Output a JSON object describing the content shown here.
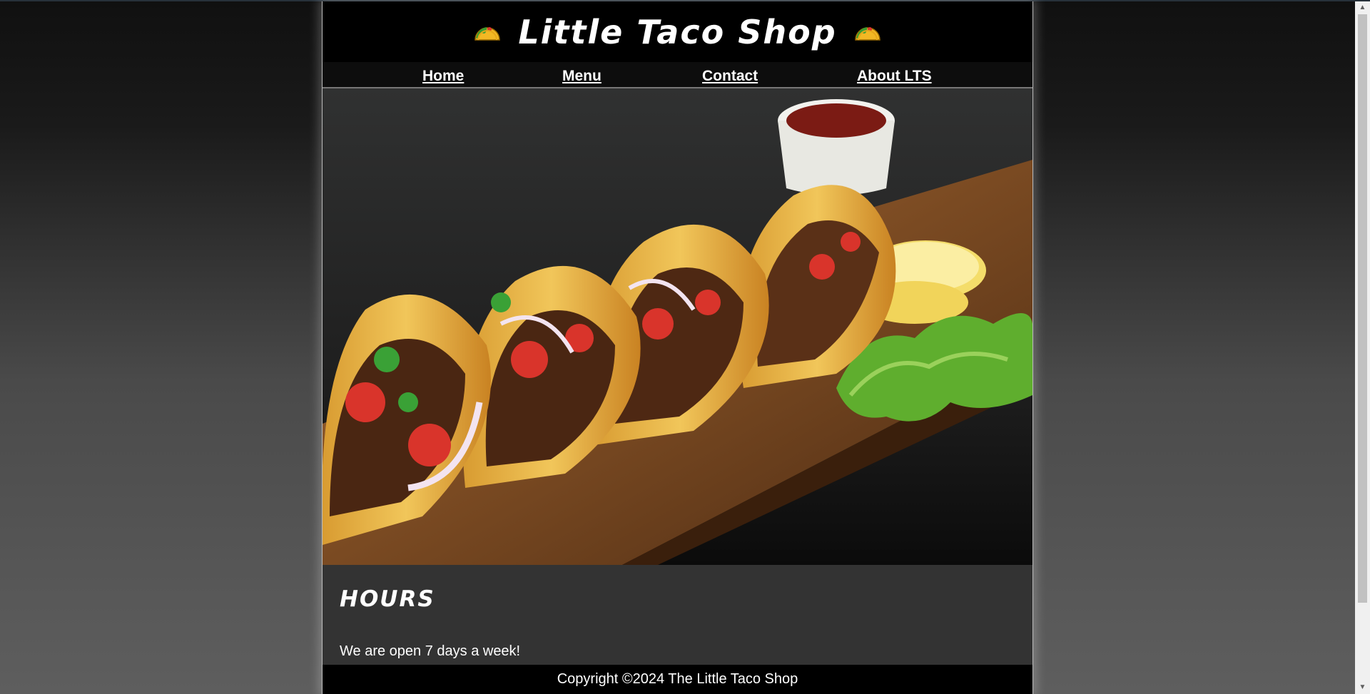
{
  "header": {
    "title": "Little Taco Shop",
    "left_icon": "taco-icon",
    "right_icon": "taco-icon"
  },
  "nav": {
    "items": [
      {
        "label": "Home"
      },
      {
        "label": "Menu"
      },
      {
        "label": "Contact"
      },
      {
        "label": "About LTS"
      }
    ]
  },
  "hero": {
    "image": "tacos-on-wooden-board-photo"
  },
  "main": {
    "heading": "HOURS",
    "text": "We are open 7 days a week!"
  },
  "footer": {
    "copyright": "Copyright ©2024 The Little Taco Shop"
  },
  "colors": {
    "page_background": "#000000",
    "content_background": "#333333",
    "text": "#ffffff"
  }
}
